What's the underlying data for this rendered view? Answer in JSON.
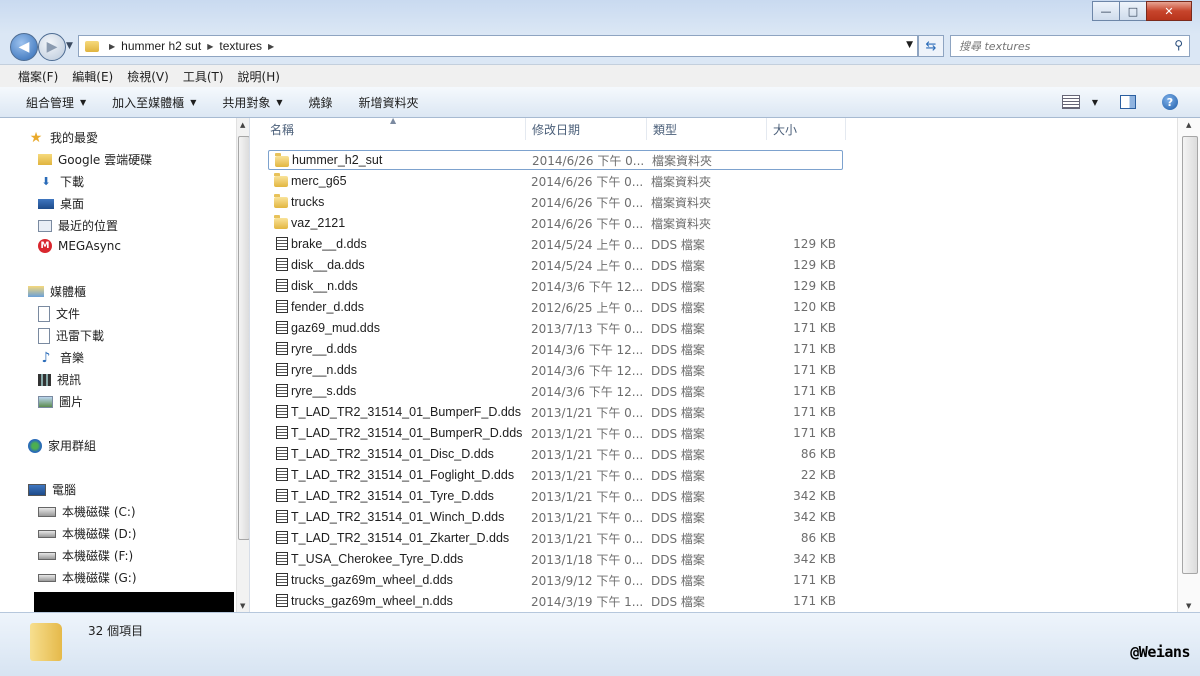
{
  "window": {
    "caption": {
      "minimize": "—",
      "maximize": "□",
      "close": "✕"
    }
  },
  "address": {
    "crumbs": [
      "hummer h2 sut",
      "textures"
    ],
    "search_placeholder": "搜尋 textures"
  },
  "menu": [
    "檔案(F)",
    "編輯(E)",
    "檢視(V)",
    "工具(T)",
    "說明(H)"
  ],
  "commands": [
    "組合管理",
    "加入至媒體櫃",
    "共用對象",
    "燒錄",
    "新增資料夾"
  ],
  "nav": {
    "favorites_title": "我的最愛",
    "favorites": [
      "Google 雲端硬碟",
      "下載",
      "桌面",
      "最近的位置",
      "MEGAsync"
    ],
    "libraries_title": "媒體櫃",
    "libraries": [
      "文件",
      "迅雷下載",
      "音樂",
      "視訊",
      "圖片"
    ],
    "homegroup": "家用群組",
    "computer_title": "電腦",
    "drives": [
      "本機磁碟 (C:)",
      "本機磁碟 (D:)",
      "本機磁碟 (F:)",
      "本機磁碟 (G:)"
    ]
  },
  "columns": {
    "name": "名稱",
    "date": "修改日期",
    "type": "類型",
    "size": "大小"
  },
  "files": [
    {
      "name": "hummer_h2_sut",
      "date": "2014/6/26 下午 0...",
      "type": "檔案資料夾",
      "size": "",
      "kind": "folder"
    },
    {
      "name": "merc_g65",
      "date": "2014/6/26 下午 0...",
      "type": "檔案資料夾",
      "size": "",
      "kind": "folder"
    },
    {
      "name": "trucks",
      "date": "2014/6/26 下午 0...",
      "type": "檔案資料夾",
      "size": "",
      "kind": "folder"
    },
    {
      "name": "vaz_2121",
      "date": "2014/6/26 下午 0...",
      "type": "檔案資料夾",
      "size": "",
      "kind": "folder"
    },
    {
      "name": "brake__d.dds",
      "date": "2014/5/24 上午 0...",
      "type": "DDS 檔案",
      "size": "129 KB",
      "kind": "file"
    },
    {
      "name": "disk__da.dds",
      "date": "2014/5/24 上午 0...",
      "type": "DDS 檔案",
      "size": "129 KB",
      "kind": "file"
    },
    {
      "name": "disk__n.dds",
      "date": "2014/3/6 下午 12...",
      "type": "DDS 檔案",
      "size": "129 KB",
      "kind": "file"
    },
    {
      "name": "fender_d.dds",
      "date": "2012/6/25 上午 0...",
      "type": "DDS 檔案",
      "size": "120 KB",
      "kind": "file"
    },
    {
      "name": "gaz69_mud.dds",
      "date": "2013/7/13 下午 0...",
      "type": "DDS 檔案",
      "size": "171 KB",
      "kind": "file"
    },
    {
      "name": "ryre__d.dds",
      "date": "2014/3/6 下午 12...",
      "type": "DDS 檔案",
      "size": "171 KB",
      "kind": "file"
    },
    {
      "name": "ryre__n.dds",
      "date": "2014/3/6 下午 12...",
      "type": "DDS 檔案",
      "size": "171 KB",
      "kind": "file"
    },
    {
      "name": "ryre__s.dds",
      "date": "2014/3/6 下午 12...",
      "type": "DDS 檔案",
      "size": "171 KB",
      "kind": "file"
    },
    {
      "name": "T_LAD_TR2_31514_01_BumperF_D.dds",
      "date": "2013/1/21 下午 0...",
      "type": "DDS 檔案",
      "size": "171 KB",
      "kind": "file"
    },
    {
      "name": "T_LAD_TR2_31514_01_BumperR_D.dds",
      "date": "2013/1/21 下午 0...",
      "type": "DDS 檔案",
      "size": "171 KB",
      "kind": "file"
    },
    {
      "name": "T_LAD_TR2_31514_01_Disc_D.dds",
      "date": "2013/1/21 下午 0...",
      "type": "DDS 檔案",
      "size": "86 KB",
      "kind": "file"
    },
    {
      "name": "T_LAD_TR2_31514_01_Foglight_D.dds",
      "date": "2013/1/21 下午 0...",
      "type": "DDS 檔案",
      "size": "22 KB",
      "kind": "file"
    },
    {
      "name": "T_LAD_TR2_31514_01_Tyre_D.dds",
      "date": "2013/1/21 下午 0...",
      "type": "DDS 檔案",
      "size": "342 KB",
      "kind": "file"
    },
    {
      "name": "T_LAD_TR2_31514_01_Winch_D.dds",
      "date": "2013/1/21 下午 0...",
      "type": "DDS 檔案",
      "size": "342 KB",
      "kind": "file"
    },
    {
      "name": "T_LAD_TR2_31514_01_Zkarter_D.dds",
      "date": "2013/1/21 下午 0...",
      "type": "DDS 檔案",
      "size": "86 KB",
      "kind": "file"
    },
    {
      "name": "T_USA_Cherokee_Tyre_D.dds",
      "date": "2013/1/18 下午 0...",
      "type": "DDS 檔案",
      "size": "342 KB",
      "kind": "file"
    },
    {
      "name": "trucks_gaz69m_wheel_d.dds",
      "date": "2013/9/12 下午 0...",
      "type": "DDS 檔案",
      "size": "171 KB",
      "kind": "file"
    },
    {
      "name": "trucks_gaz69m_wheel_n.dds",
      "date": "2014/3/19 下午 1...",
      "type": "DDS 檔案",
      "size": "171 KB",
      "kind": "file"
    }
  ],
  "status": {
    "count": "32 個項目"
  },
  "watermark": "@Weians"
}
